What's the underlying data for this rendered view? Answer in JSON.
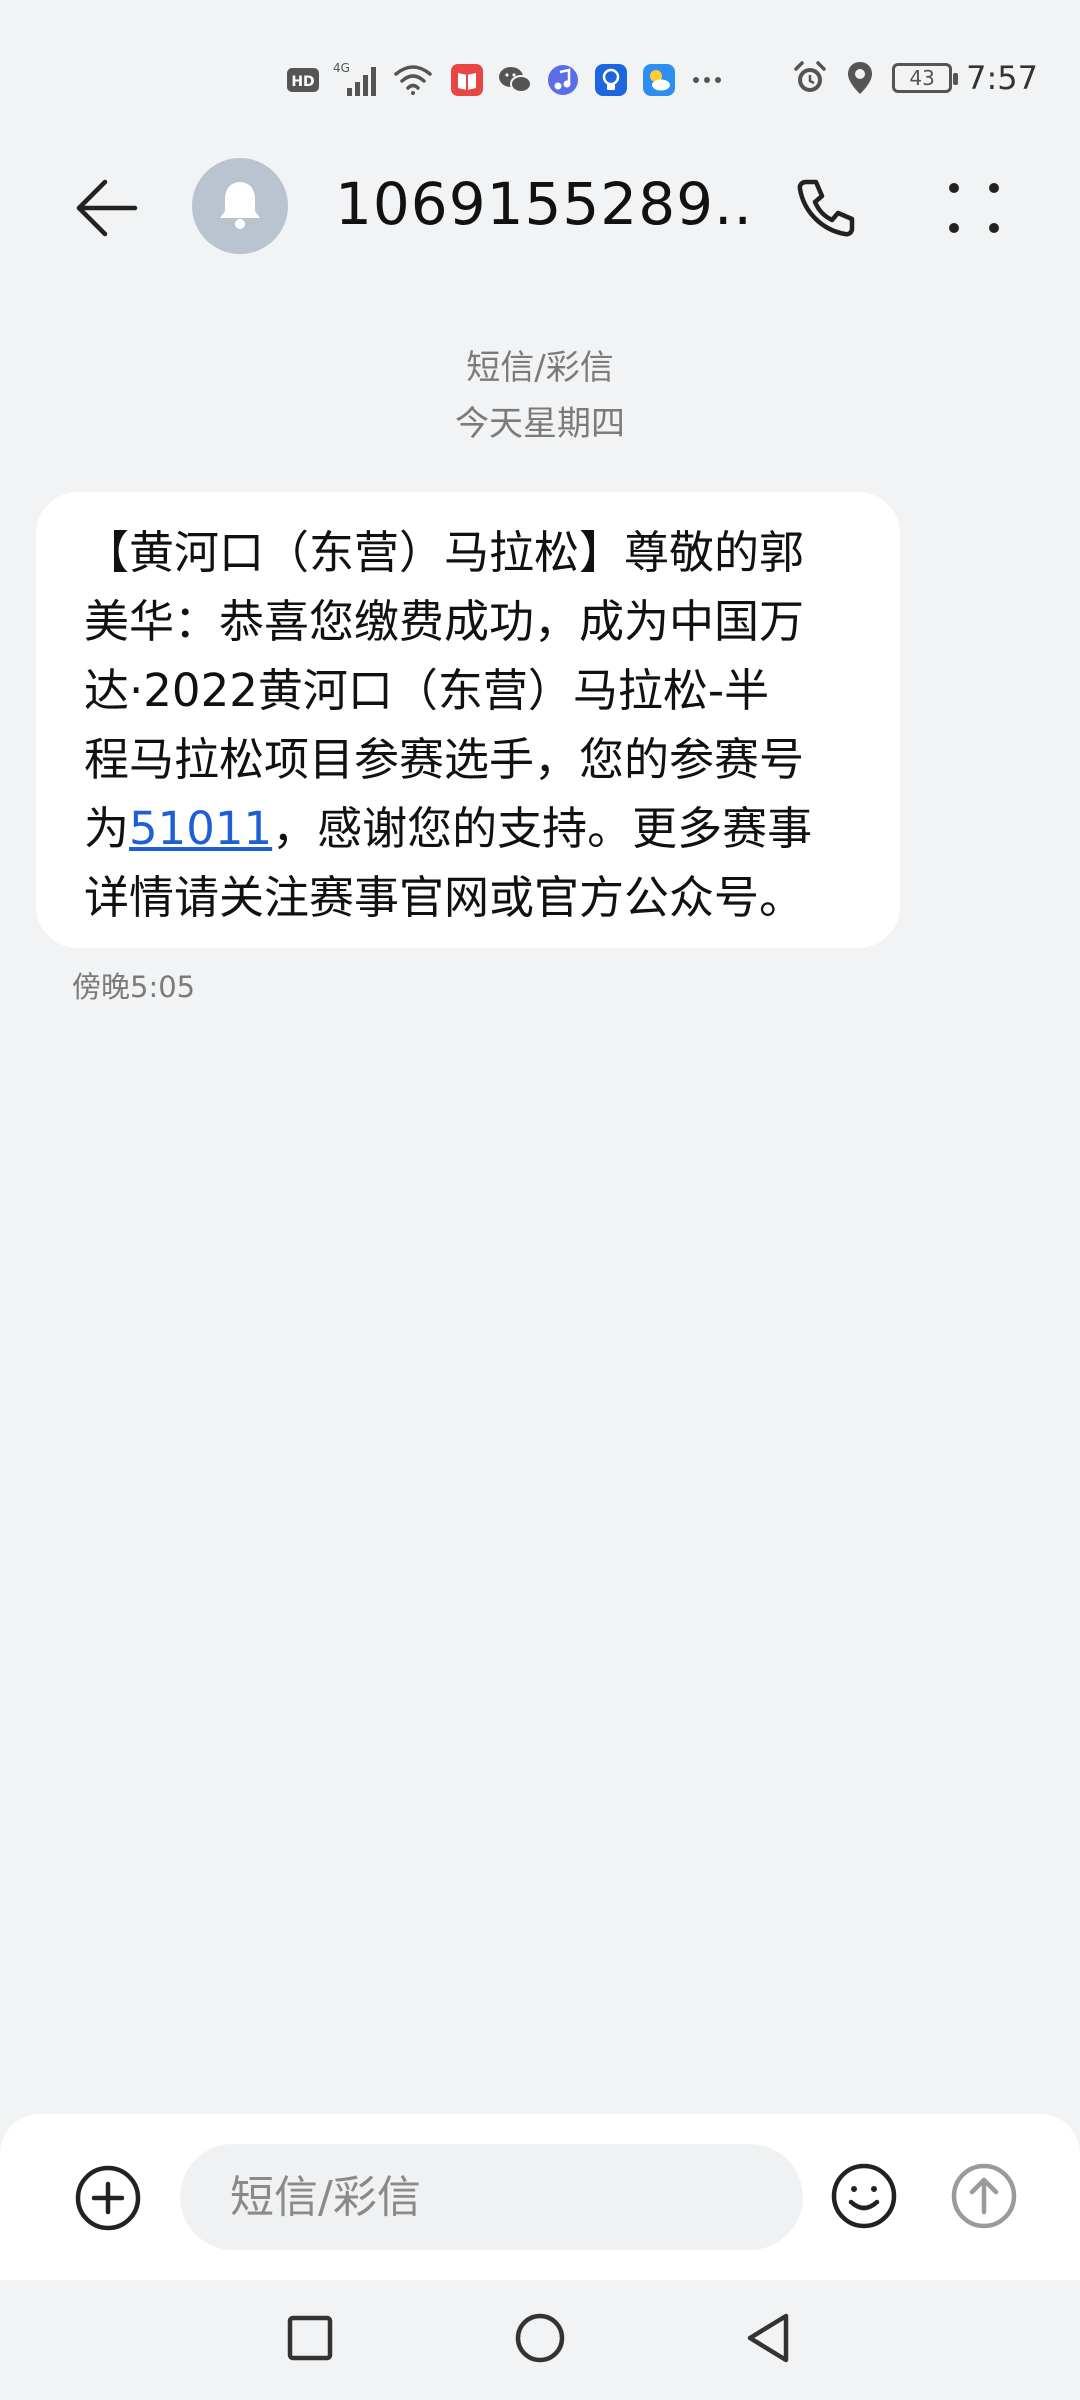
{
  "status_bar": {
    "network": "4G",
    "battery": "43",
    "time": "7:57",
    "icons": [
      "hd-icon",
      "signal-icon",
      "wifi-icon",
      "book-app-icon",
      "wechat-icon",
      "music-app-icon",
      "bulb-app-icon",
      "weather-app-icon",
      "more-notifications-icon",
      "alarm-icon",
      "location-icon"
    ]
  },
  "header": {
    "title": "1069155289...",
    "back_icon": "back-arrow-icon",
    "avatar_icon": "bell-icon",
    "call_icon": "phone-icon",
    "more_icon": "more-icon"
  },
  "conversation": {
    "type_label": "短信/彩信",
    "date_label": "今天星期四"
  },
  "message": {
    "lines": [
      "【黄河口（东营）马拉松】尊敬的郭",
      "美华：恭喜您缴费成功，成为中国万",
      "达·2022黄河口（东营）马拉松-半",
      "程马拉松项目参赛选手，您的参赛号"
    ],
    "line5_prefix": "为",
    "bib_number": "51011",
    "line5_suffix": "，感谢您的支持。更多赛事",
    "line6": "详情请关注赛事官网或官方公众号。",
    "time": "傍晚5:05"
  },
  "composer": {
    "placeholder": "短信/彩信",
    "value": ""
  },
  "colors": {
    "background": "#f1f3f5",
    "bubble": "#ffffff",
    "link": "#1f5fd6",
    "muted_text": "#7b7b7b",
    "avatar_bg": "#b9c4d0"
  }
}
